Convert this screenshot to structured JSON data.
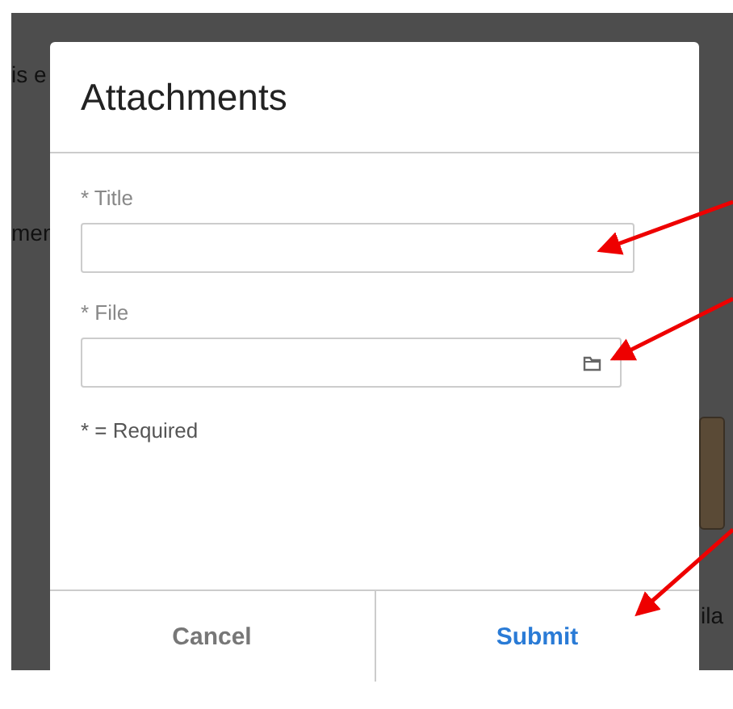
{
  "background": {
    "texts": [
      "is e",
      "men",
      "ila"
    ]
  },
  "dialog": {
    "title": "Attachments",
    "fields": [
      {
        "kind": "text",
        "label": "* Title"
      },
      {
        "kind": "file",
        "label": "* File"
      }
    ],
    "note": "* = Required",
    "buttons": [
      {
        "label": "Cancel",
        "kind": "secondary"
      },
      {
        "label": "Submit",
        "kind": "primary"
      }
    ]
  },
  "annotations": [
    {
      "kind": "arrow"
    },
    {
      "kind": "arrow"
    },
    {
      "kind": "arrow"
    }
  ]
}
